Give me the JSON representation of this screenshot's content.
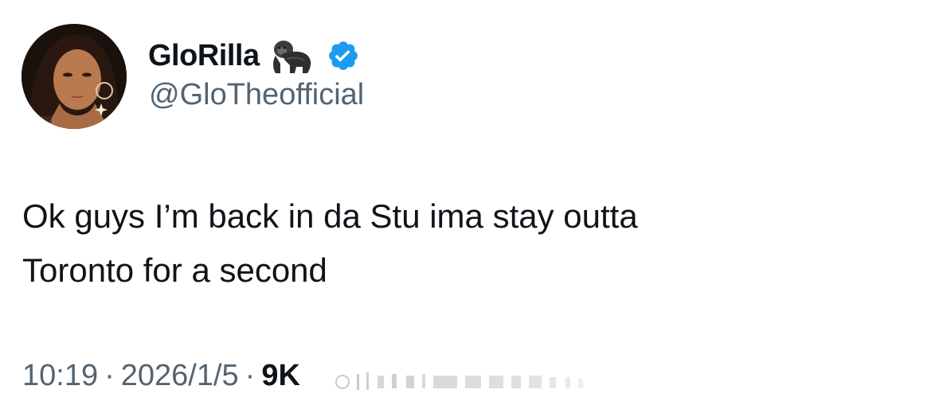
{
  "author": {
    "display_name": "GloRilla",
    "handle": "@GloTheofficial",
    "name_emoji": "gorilla-icon",
    "verified_badge": "verified-icon",
    "verified_color": "#1d9bf0"
  },
  "tweet": {
    "text_line1": "Ok guys I’m back in da Stu ima stay outta",
    "text_line2": "Toronto for a second"
  },
  "meta": {
    "time": "10:19",
    "separator": "·",
    "date": "2026/1/5",
    "views": "9K"
  },
  "colors": {
    "text_primary": "#0f1419",
    "text_secondary": "#536471",
    "background": "#ffffff"
  }
}
